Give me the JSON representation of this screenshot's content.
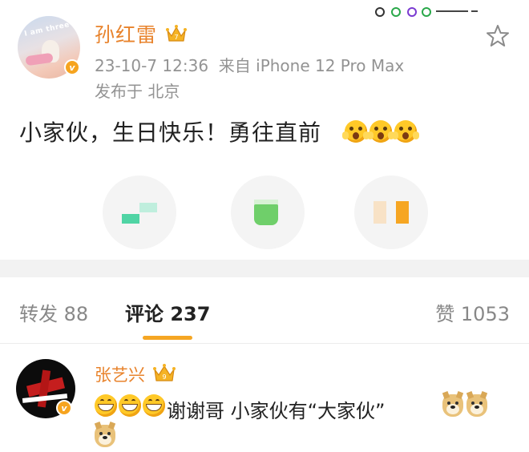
{
  "post": {
    "author": "孙红雷",
    "timestamp": "23-10-7 12:36",
    "source": "来自 iPhone 12 Pro Max",
    "location": "发布于 北京",
    "text": "小家伙，生日快乐！勇往直前",
    "avatar_caption": "I am three"
  },
  "tabs": {
    "repost": "转发 88",
    "comment": "评论 237",
    "like": "赞 1053"
  },
  "comment": {
    "author": "张艺兴",
    "text": "谢谢哥 小家伙有“大家伙”"
  },
  "icons": {
    "star": "star-icon",
    "verified": "verified-badge-icon",
    "crown": "crown-icon"
  },
  "colors": {
    "accent": "#f5a623",
    "username": "#e8832c",
    "meta": "#939393"
  }
}
